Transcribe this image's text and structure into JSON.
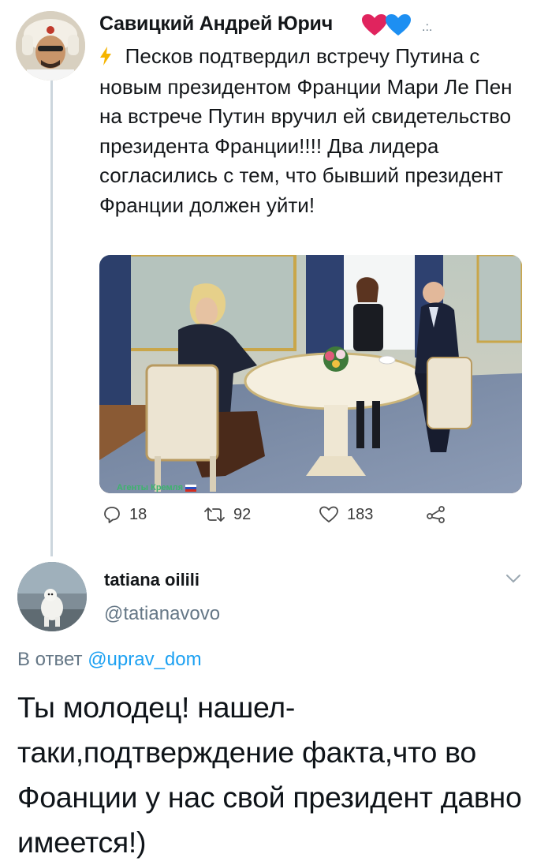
{
  "tweet": {
    "author_name": "Савицкий Андрей Юрич",
    "text": "Песков подтвердил встречу Путина с новым президентом Франции Мари Ле Пен на встрече Путин вручил ей свидетельство президента Франции!!!! Два лидера согласились с тем, что бывший президент Франции должен уйти!",
    "image_watermark": "Агенты Кремля",
    "actions": {
      "replies": "18",
      "retweets": "92",
      "likes": "183"
    }
  },
  "reply": {
    "author_name": "tatiana oilili",
    "handle": "@tatianavovo",
    "reply_prefix": "В ответ",
    "reply_to_handle": "@uprav_dom",
    "text": "Ты молодец! нашел-таки,подтверждение факта,что во Фоанции у нас свой президент давно имеется!)"
  },
  "colors": {
    "link": "#1da1f2",
    "muted": "#657786",
    "text": "#14171a",
    "heart_red": "#e0245e",
    "heart_blue": "#1d8ff2"
  },
  "icons": [
    "reply-icon",
    "retweet-icon",
    "like-icon",
    "share-icon",
    "chevron-down-icon",
    "lightning-icon",
    "red-heart-icon",
    "blue-heart-icon"
  ]
}
